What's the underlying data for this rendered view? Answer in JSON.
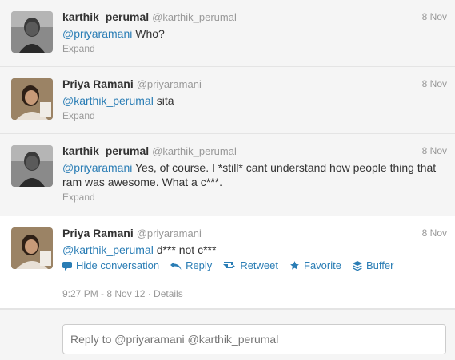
{
  "tweets": [
    {
      "fullname": "karthik_perumal",
      "username": "@karthik_perumal",
      "time": "8 Nov",
      "mention": "@priyaramani",
      "text": " Who?",
      "expand": "Expand",
      "avatar": "avatar-karthik"
    },
    {
      "fullname": "Priya Ramani",
      "username": "@priyaramani",
      "time": "8 Nov",
      "mention": "@karthik_perumal",
      "text": " sita",
      "expand": "Expand",
      "avatar": "avatar-priya"
    },
    {
      "fullname": "karthik_perumal",
      "username": "@karthik_perumal",
      "time": "8 Nov",
      "mention": "@priyaramani",
      "text": " Yes, of course. I *still* cant understand how people thing that ram was awesome. What a c***.",
      "expand": "Expand",
      "avatar": "avatar-karthik"
    },
    {
      "fullname": "Priya Ramani",
      "username": "@priyaramani",
      "time": "8 Nov",
      "mention": "@karthik_perumal",
      "text": " d*** not c***",
      "avatar": "avatar-priya",
      "actions": {
        "hide": "Hide conversation",
        "reply": "Reply",
        "retweet": "Retweet",
        "favorite": "Favorite",
        "buffer": "Buffer"
      },
      "meta": "9:27 PM - 8 Nov 12 · Details"
    }
  ],
  "reply_box": {
    "placeholder": "Reply to @priyaramani @karthik_perumal"
  },
  "colors": {
    "link": "#2a7db5",
    "muted": "#999999",
    "text": "#333333"
  }
}
